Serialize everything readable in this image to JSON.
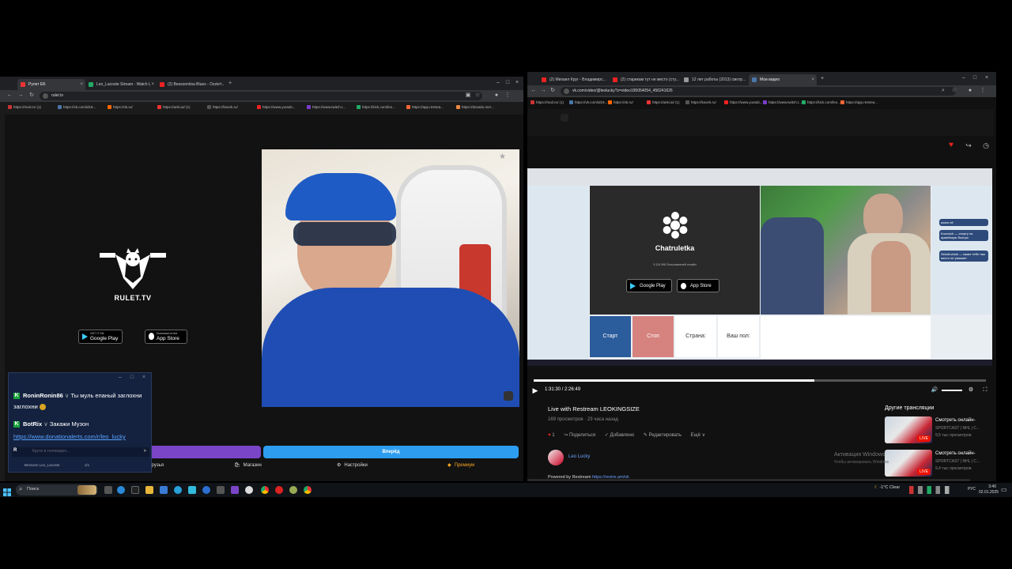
{
  "left_browser": {
    "tabs": [
      {
        "label": "Рулет ЕБ",
        "color": "#e33",
        "active": true
      },
      {
        "label": "Leo_Lacoste Stream - Watch L",
        "color": "#2a6",
        "active": false
      },
      {
        "label": "(2) Bessonnitsa Blues - Ozzie ...",
        "color": "#e22",
        "active": false
      }
    ],
    "new_tab": "+",
    "url": "rulet.tv",
    "bookmarks": [
      "https://mail.ru/ (1)",
      "https://vk.com/id19...",
      "https://ok.ru/",
      "https://anki.ai/ (1)",
      "https://kwork.ru/",
      "https://www.youtub...",
      "https://www.twitch.t...",
      "https://kick.com/leo...",
      "https://app.restrea...",
      "https://donatio.me/..."
    ]
  },
  "rulet": {
    "logo_text": "RULET.TV",
    "google_play": {
      "small": "GET IT ON",
      "big": "Google Play"
    },
    "app_store": {
      "small": "Download on the",
      "big": "App Store"
    },
    "start_button": "Вперёд",
    "nav": [
      {
        "label": "Друзья",
        "icon": "friends-icon"
      },
      {
        "label": "Магазин",
        "icon": "shop-icon"
      },
      {
        "label": "Настройки",
        "icon": "gear-icon"
      },
      {
        "label": "Премиум",
        "icon": "premium-icon"
      }
    ],
    "accent_blue": "#2d9df0",
    "accent_purple": "#7b45c8"
  },
  "chat": {
    "messages": [
      {
        "user": "RoninRonin86",
        "text": "Ты муль епаный заглохни"
      },
      {
        "user": "BotRix",
        "text": "Закажи Музон"
      }
    ],
    "link": "https://www.donationalerts.com/r/leo_lucky",
    "input_placeholder": "Круто в телевидео...",
    "footer_name": "Bessonn Leo_Lacoste",
    "footer_count": "1/1"
  },
  "right_browser": {
    "tabs": [
      {
        "label": "(2) Михаил Круг - Владимирс...",
        "color": "#e22",
        "active": false
      },
      {
        "label": "(2) старикам тут не место (сту...",
        "color": "#e22",
        "active": false
      },
      {
        "label": "12 лет работы (2013) смотр...",
        "color": "#999",
        "active": false
      },
      {
        "label": "Мои видео",
        "color": "#4a76a8",
        "active": true
      }
    ],
    "url": "vk.com/video/@leolucky?z=video195054054_456241626",
    "bookmarks": [
      "https://mail.ru/ (1)",
      "https://vk.com/id19...",
      "https://ok.ru/",
      "https://anki.ai/ (1)",
      "https://kwork.ru/",
      "https://www.youtub...",
      "https://www.twitch.t...",
      "https://kick.com/leo...",
      "https://app.restrea..."
    ]
  },
  "video": {
    "time": "1:31:30 / 2:26:49",
    "progress": 0.62,
    "title": "Live with Restream LEOKINGSIZE",
    "meta": "169 просмотров · 23 часа назад",
    "like_count": "1",
    "actions": [
      "Поделиться",
      "Добавлено",
      "Редактировать",
      "Ещё"
    ],
    "author": "Leo Lucky",
    "powered_label": "Powered by Restream",
    "powered_link": "https://restre.am/vk",
    "activation_title": "Активация Windows",
    "activation_sub": "Чтобы активировать Windows"
  },
  "inner": {
    "brand": "Chatruletka",
    "online": "5 124 098 Пользователей онлайн",
    "google_play": "Google Play",
    "app_store": "App Store",
    "buttons": {
      "start": "Старт",
      "stop": "Стоп",
      "country": "Страна:",
      "gender": "Ваш пол:"
    },
    "chat_snippets": [
      "молю её",
      "Kuzovich — спорту на армейскую быстро",
      "Sekobuchok — какие тебе там место не уважает"
    ]
  },
  "other_streams": {
    "heading": "Другие трансляции",
    "items": [
      {
        "title": "Смотреть онлайн-",
        "channel": "SPORTCAST | NHL | С...",
        "views": "9,5 тыс просмотров",
        "badge": "LIVE"
      },
      {
        "title": "Смотреть онлайн-",
        "channel": "SPORTCAST | NHL | С...",
        "views": "9,4 тыс просмотров",
        "badge": "LIVE"
      }
    ]
  },
  "taskbar": {
    "search": "Поиск",
    "weather": "-1°C Clear",
    "lang": "РУС",
    "time": "3:40",
    "date": "02.01.2025"
  }
}
